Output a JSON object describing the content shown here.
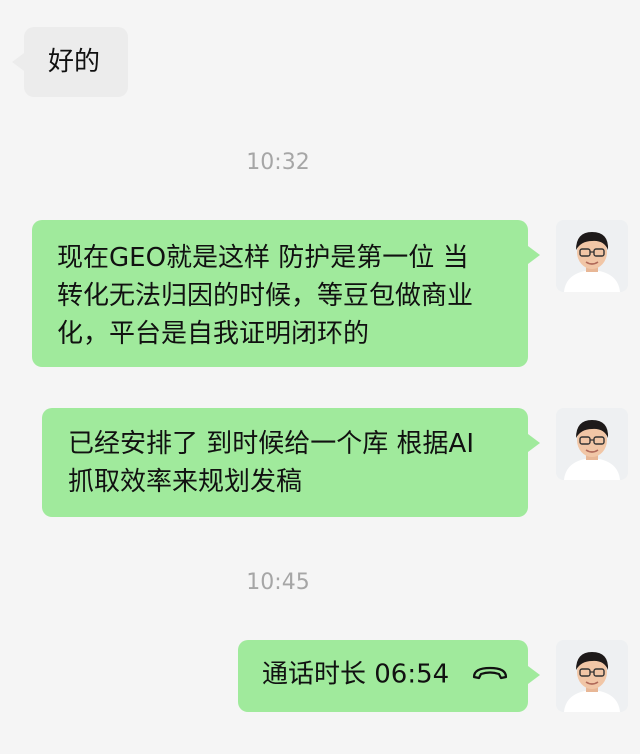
{
  "messages": [
    {
      "type": "received",
      "text": "好的"
    },
    {
      "type": "time",
      "text": "10:32"
    },
    {
      "type": "sent",
      "lines": [
        "现在GEO就是这样 防护是第一位 当",
        "转化无法归因的时候，等豆包做商业",
        "化，平台是自我证明闭环的"
      ]
    },
    {
      "type": "sent",
      "lines": [
        "已经安排了 到时候给一个库 根据AI",
        "抓取效率来规划发稿"
      ]
    },
    {
      "type": "time",
      "text": "10:45"
    },
    {
      "type": "call",
      "label": "通话时长 06:54",
      "icon": "phone-hangup-icon"
    }
  ],
  "colors": {
    "background": "#f5f5f5",
    "sent_bubble": "#a0ea9c",
    "received_bubble": "#ececec",
    "timestamp": "#a6a6a6"
  }
}
